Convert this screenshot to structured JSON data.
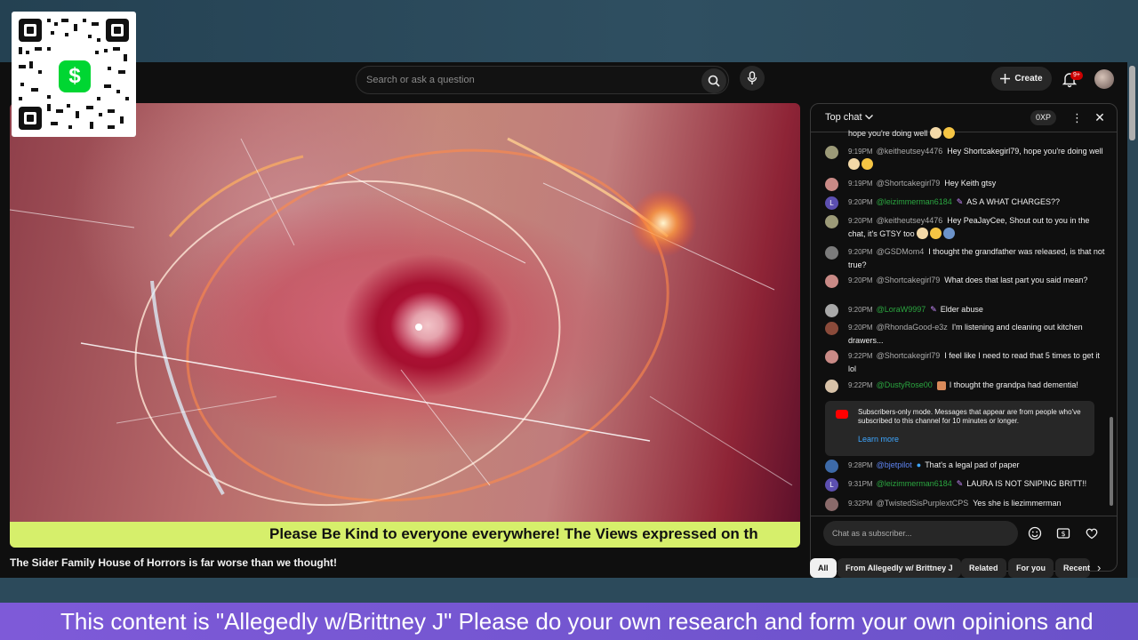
{
  "masthead": {
    "search_placeholder": "Search or ask a question",
    "create_label": "Create",
    "notifications_badge": "9+"
  },
  "video": {
    "ticker_text": "Please Be Kind to everyone everywhere! The Views expressed on th",
    "title": "The Sider Family House of Horrors is far worse than we thought!"
  },
  "chat": {
    "title": "Top chat",
    "xp_label": "0XP",
    "partial_top_text": "hope you're doing well",
    "messages": [
      {
        "time": "9:19PM",
        "author": "@keitheutsey4476",
        "text": "Hey Shortcakegirl79, hope you're doing well"
      },
      {
        "time": "9:19PM",
        "author": "@Shortcakegirl79",
        "text": "Hey Keith gtsy"
      },
      {
        "time": "9:20PM",
        "author": "@leizimmerman6184",
        "text": "AS A WHAT CHARGES??"
      },
      {
        "time": "9:20PM",
        "author": "@keitheutsey4476",
        "text": "Hey PeaJayCee, Shout out to you in the chat, it's GTSY too"
      },
      {
        "time": "9:20PM",
        "author": "@GSDMom4",
        "text": "I thought the grandfather was released, is that not true?"
      },
      {
        "time": "9:20PM",
        "author": "@Shortcakegirl79",
        "text": "What does that last part you said mean?"
      },
      {
        "time": "9:20PM",
        "author": "@LoraW9997",
        "text": "Elder abuse"
      },
      {
        "time": "9:20PM",
        "author": "@RhondaGood-e3z",
        "text": "I'm listening and cleaning out kitchen drawers..."
      },
      {
        "time": "9:22PM",
        "author": "@Shortcakegirl79",
        "text": "I feel like I need to read that 5 times to get it lol"
      },
      {
        "time": "9:22PM",
        "author": "@DustyRose00",
        "text": "I thought the grandpa had dementia!"
      },
      {
        "time": "9:28PM",
        "author": "@bjetpilot",
        "text": "That's a legal pad of paper"
      },
      {
        "time": "9:31PM",
        "author": "@leizimmerman6184",
        "text": "LAURA IS NOT SNIPING BRITT!!"
      },
      {
        "time": "9:32PM",
        "author": "@TwistedSisPurplextCPS",
        "text": "Yes she is liezimmerman"
      }
    ],
    "notice_text": "Subscribers-only mode. Messages that appear are from people who've subscribed to this channel for 10 minutes or longer.",
    "notice_link": "Learn more",
    "input_placeholder": "Chat as a subscriber..."
  },
  "chips": [
    "All",
    "From Allegedly w/ Brittney J",
    "Related",
    "For you",
    "Recent"
  ],
  "overlay": {
    "qr_symbol": "$",
    "banner_text": "This content is \"Allegedly w/Brittney J\" Please do your own research and form your own opinions and"
  },
  "colors": {
    "cashapp_green": "#00d632",
    "ticker_bg": "#d6ef6b",
    "banner_bg": "#7e5ad8",
    "member_green": "#2ba640"
  }
}
